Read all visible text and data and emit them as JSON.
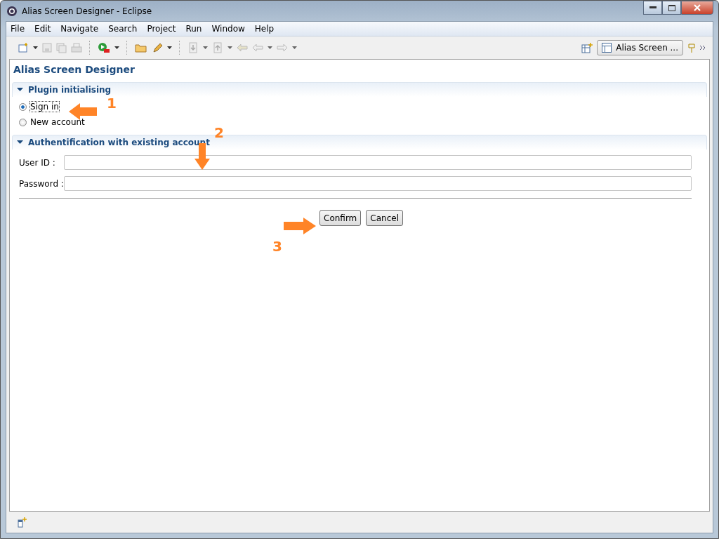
{
  "window": {
    "title": "Alias Screen Designer - Eclipse"
  },
  "menu": [
    "File",
    "Edit",
    "Navigate",
    "Search",
    "Project",
    "Run",
    "Window",
    "Help"
  ],
  "perspective": {
    "label": "Alias Screen ..."
  },
  "editor": {
    "title": "Alias Screen Designer",
    "sections": [
      {
        "kind": "radios",
        "title": "Plugin initialising",
        "expanded": true,
        "options": [
          {
            "label": "Sign in",
            "selected": true
          },
          {
            "label": "New account",
            "selected": false
          }
        ]
      },
      {
        "kind": "form",
        "title": "Authentification with existing account",
        "expanded": true,
        "fields": [
          {
            "label": "User ID :"
          },
          {
            "label": "Password :"
          }
        ]
      }
    ],
    "buttons": [
      "Confirm",
      "Cancel"
    ]
  },
  "annotations": [
    {
      "number": "1",
      "kind": "left"
    },
    {
      "number": "2",
      "kind": "down"
    },
    {
      "number": "3",
      "kind": "right"
    }
  ]
}
